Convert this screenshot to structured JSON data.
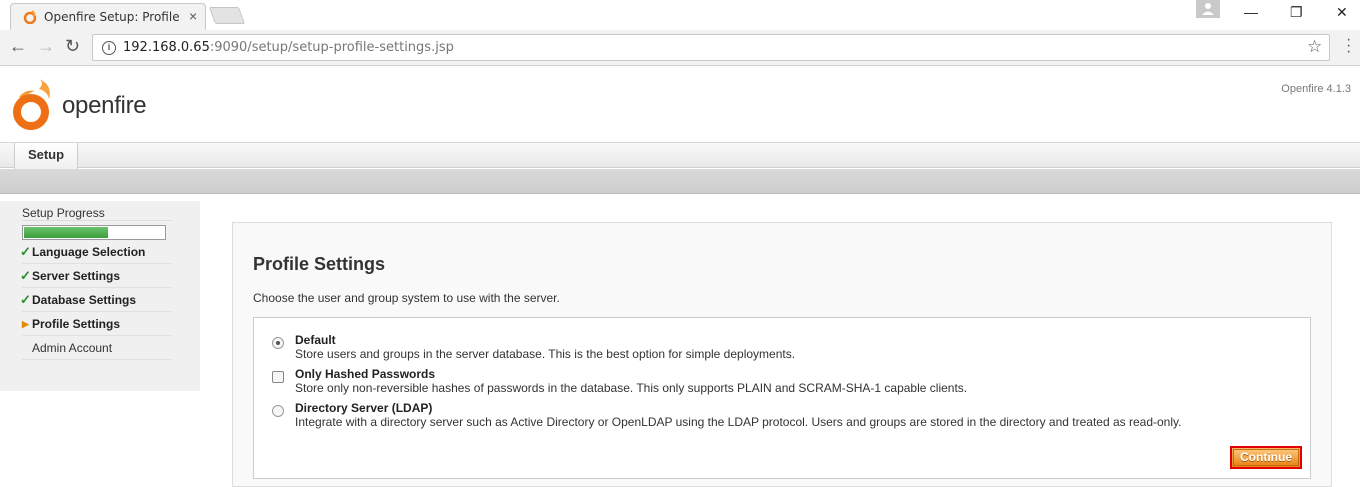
{
  "browser": {
    "tab_title": "Openfire Setup: Profile Se",
    "url_host": "192.168.0.65",
    "url_path": ":9090/setup/setup-profile-settings.jsp"
  },
  "header": {
    "logo_text": "openfire",
    "version": "Openfire 4.1.3"
  },
  "nav": {
    "tab_label": "Setup"
  },
  "sidebar": {
    "title": "Setup Progress",
    "progress": 0.6,
    "items": [
      {
        "label": "Language Selection",
        "state": "done"
      },
      {
        "label": "Server Settings",
        "state": "done"
      },
      {
        "label": "Database Settings",
        "state": "done"
      },
      {
        "label": "Profile Settings",
        "state": "current"
      },
      {
        "label": "Admin Account",
        "state": "pending"
      }
    ]
  },
  "main": {
    "heading": "Profile Settings",
    "description": "Choose the user and group system to use with the server.",
    "options": [
      {
        "title": "Default",
        "desc": "Store users and groups in the server database. This is the best option for simple deployments.",
        "control": "radio",
        "checked": true
      },
      {
        "title": "Only Hashed Passwords",
        "desc": "Store only non-reversible hashes of passwords in the database. This only supports PLAIN and SCRAM-SHA-1 capable clients.",
        "control": "checkbox",
        "checked": false
      },
      {
        "title": "Directory Server (LDAP)",
        "desc": "Integrate with a directory server such as Active Directory or OpenLDAP using the LDAP protocol. Users and groups are stored in the directory and treated as read-only.",
        "control": "radio",
        "checked": false
      }
    ],
    "continue_label": "Continue"
  },
  "colors": {
    "accent": "#e8861a",
    "progress": "#4caf50",
    "check": "#2e8b2e"
  }
}
